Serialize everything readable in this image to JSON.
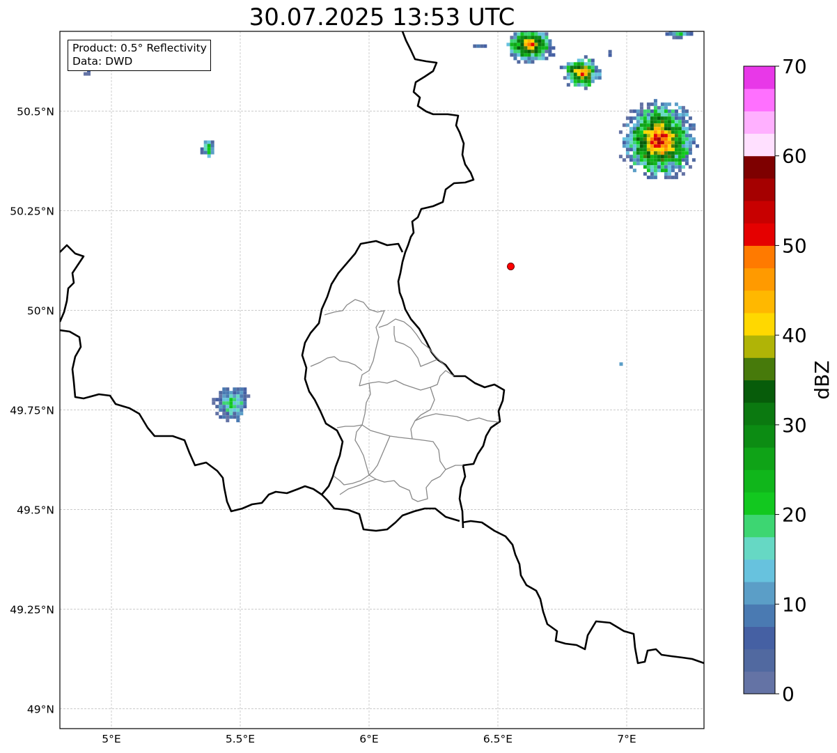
{
  "title": "30.07.2025 13:53 UTC",
  "info_box": {
    "product": "Product: 0.5° Reflectivity",
    "data": "Data: DWD"
  },
  "map": {
    "lon_range": [
      4.8,
      7.3
    ],
    "lat_range": [
      48.95,
      50.7
    ],
    "lon_ticks": [
      {
        "value": 5.0,
        "label": "5°E"
      },
      {
        "value": 5.5,
        "label": "5.5°E"
      },
      {
        "value": 6.0,
        "label": "6°E"
      },
      {
        "value": 6.5,
        "label": "6.5°E"
      },
      {
        "value": 7.0,
        "label": "7°E"
      }
    ],
    "lat_ticks": [
      {
        "value": 49.0,
        "label": "49°N"
      },
      {
        "value": 49.25,
        "label": "49.25°N"
      },
      {
        "value": 49.5,
        "label": "49.5°N"
      },
      {
        "value": 49.75,
        "label": "49.75°N"
      },
      {
        "value": 50.0,
        "label": "50°N"
      },
      {
        "value": 50.25,
        "label": "50.25°N"
      },
      {
        "value": 50.5,
        "label": "50.5°N"
      }
    ],
    "gridlines": true,
    "marker": {
      "lon": 6.55,
      "lat": 50.11,
      "color": "#ff0000"
    }
  },
  "colorbar": {
    "label": "dBZ",
    "min": 0,
    "max": 70,
    "step": 2.5,
    "ticks": [
      0,
      10,
      20,
      30,
      40,
      50,
      60,
      70
    ],
    "colors": [
      "#6473a5",
      "#5169a0",
      "#4560a3",
      "#4a7ab2",
      "#5b9ec7",
      "#67c2de",
      "#66d8c4",
      "#3dd672",
      "#12c81f",
      "#10b61b",
      "#0fa317",
      "#0c8c13",
      "#0b7910",
      "#075c0a",
      "#477a0b",
      "#b0b406",
      "#ffd800",
      "#ffb800",
      "#ff9a00",
      "#ff7a00",
      "#e50000",
      "#c80000",
      "#a50000",
      "#7e0000",
      "#ffe0ff",
      "#ffb0ff",
      "#ff70ff",
      "#e838e8"
    ]
  },
  "echoes": [
    {
      "name": "north-cell-a",
      "lon": 6.62,
      "lat": 50.67,
      "rx": 0.1,
      "ry": 0.045,
      "max_dbz": 50
    },
    {
      "name": "north-cell-b",
      "lon": 6.82,
      "lat": 50.6,
      "rx": 0.08,
      "ry": 0.04,
      "max_dbz": 52
    },
    {
      "name": "north-cell-c",
      "lon": 7.2,
      "lat": 50.7,
      "rx": 0.05,
      "ry": 0.015,
      "max_dbz": 25
    },
    {
      "name": "east-cell",
      "lon": 7.12,
      "lat": 50.43,
      "rx": 0.15,
      "ry": 0.1,
      "max_dbz": 55
    },
    {
      "name": "west-small-echo",
      "lon": 5.37,
      "lat": 50.41,
      "rx": 0.025,
      "ry": 0.025,
      "max_dbz": 25
    },
    {
      "name": "west-echo",
      "lon": 5.46,
      "lat": 49.77,
      "rx": 0.07,
      "ry": 0.045,
      "max_dbz": 22
    },
    {
      "name": "east-small-echo",
      "lon": 6.97,
      "lat": 49.87,
      "rx": 0.012,
      "ry": 0.008,
      "max_dbz": 12
    },
    {
      "name": "nw-speck",
      "lon": 4.9,
      "lat": 50.6,
      "rx": 0.008,
      "ry": 0.015,
      "max_dbz": 5
    },
    {
      "name": "top-speck",
      "lon": 6.42,
      "lat": 50.67,
      "rx": 0.03,
      "ry": 0.006,
      "max_dbz": 8
    },
    {
      "name": "ne-speck",
      "lon": 6.93,
      "lat": 50.65,
      "rx": 0.015,
      "ry": 0.012,
      "max_dbz": 8
    }
  ]
}
